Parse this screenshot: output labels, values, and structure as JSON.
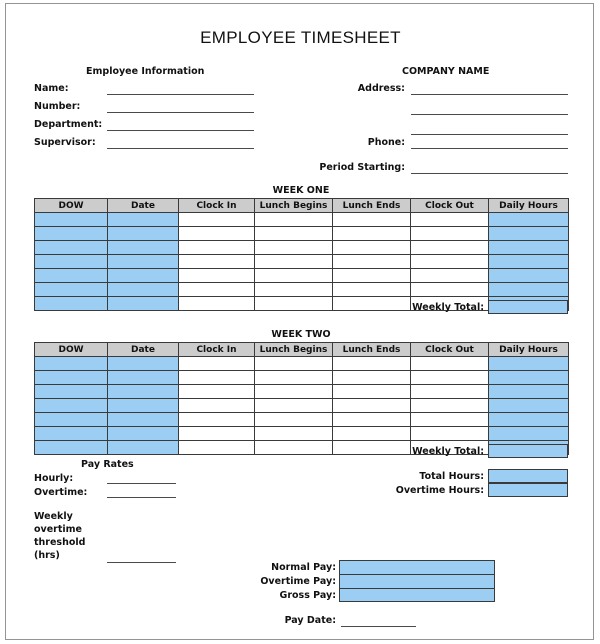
{
  "document": {
    "title": "EMPLOYEE TIMESHEET"
  },
  "employee_information": {
    "caption": "Employee Information",
    "fields": [
      {
        "label": "Name:",
        "value": ""
      },
      {
        "label": "Number:",
        "value": ""
      },
      {
        "label": "Department:",
        "value": ""
      },
      {
        "label": "Supervisor:",
        "value": ""
      }
    ]
  },
  "company_information": {
    "caption": "COMPANY NAME",
    "fields": [
      {
        "label": "Address:",
        "value": ""
      },
      {
        "label": "",
        "value": ""
      },
      {
        "label": "",
        "value": ""
      },
      {
        "label": "Phone:",
        "value": ""
      },
      {
        "label": "Period Starting:",
        "value": ""
      }
    ]
  },
  "week_one": {
    "title": "WEEK ONE",
    "columns": [
      "DOW",
      "Date",
      "Clock In",
      "Lunch Begins",
      "Lunch Ends",
      "Clock Out",
      "Daily Hours"
    ],
    "rows": [
      {
        "dow": "",
        "date": "",
        "clock_in": "",
        "lunch_begins": "",
        "lunch_ends": "",
        "clock_out": "",
        "daily_hours": ""
      },
      {
        "dow": "",
        "date": "",
        "clock_in": "",
        "lunch_begins": "",
        "lunch_ends": "",
        "clock_out": "",
        "daily_hours": ""
      },
      {
        "dow": "",
        "date": "",
        "clock_in": "",
        "lunch_begins": "",
        "lunch_ends": "",
        "clock_out": "",
        "daily_hours": ""
      },
      {
        "dow": "",
        "date": "",
        "clock_in": "",
        "lunch_begins": "",
        "lunch_ends": "",
        "clock_out": "",
        "daily_hours": ""
      },
      {
        "dow": "",
        "date": "",
        "clock_in": "",
        "lunch_begins": "",
        "lunch_ends": "",
        "clock_out": "",
        "daily_hours": ""
      },
      {
        "dow": "",
        "date": "",
        "clock_in": "",
        "lunch_begins": "",
        "lunch_ends": "",
        "clock_out": "",
        "daily_hours": ""
      },
      {
        "dow": "",
        "date": "",
        "clock_in": "",
        "lunch_begins": "",
        "lunch_ends": "",
        "clock_out": "",
        "daily_hours": ""
      }
    ],
    "weekly_total_label": "Weekly Total:",
    "weekly_total_value": ""
  },
  "week_two": {
    "title": "WEEK TWO",
    "columns": [
      "DOW",
      "Date",
      "Clock In",
      "Lunch Begins",
      "Lunch Ends",
      "Clock Out",
      "Daily Hours"
    ],
    "rows": [
      {
        "dow": "",
        "date": "",
        "clock_in": "",
        "lunch_begins": "",
        "lunch_ends": "",
        "clock_out": "",
        "daily_hours": ""
      },
      {
        "dow": "",
        "date": "",
        "clock_in": "",
        "lunch_begins": "",
        "lunch_ends": "",
        "clock_out": "",
        "daily_hours": ""
      },
      {
        "dow": "",
        "date": "",
        "clock_in": "",
        "lunch_begins": "",
        "lunch_ends": "",
        "clock_out": "",
        "daily_hours": ""
      },
      {
        "dow": "",
        "date": "",
        "clock_in": "",
        "lunch_begins": "",
        "lunch_ends": "",
        "clock_out": "",
        "daily_hours": ""
      },
      {
        "dow": "",
        "date": "",
        "clock_in": "",
        "lunch_begins": "",
        "lunch_ends": "",
        "clock_out": "",
        "daily_hours": ""
      },
      {
        "dow": "",
        "date": "",
        "clock_in": "",
        "lunch_begins": "",
        "lunch_ends": "",
        "clock_out": "",
        "daily_hours": ""
      },
      {
        "dow": "",
        "date": "",
        "clock_in": "",
        "lunch_begins": "",
        "lunch_ends": "",
        "clock_out": "",
        "daily_hours": ""
      }
    ],
    "weekly_total_label": "Weekly Total:",
    "weekly_total_value": ""
  },
  "pay_rates": {
    "caption": "Pay Rates",
    "hourly_label": "Hourly:",
    "hourly_value": "",
    "overtime_label": "Overtime:",
    "overtime_value": "",
    "threshold_label": "Weekly overtime threshold (hrs)",
    "threshold_value": ""
  },
  "hours_summary": {
    "total_hours_label": "Total Hours:",
    "total_hours_value": "",
    "overtime_hours_label": "Overtime Hours:",
    "overtime_hours_value": ""
  },
  "pay_summary": {
    "normal_pay_label": "Normal Pay:",
    "normal_pay_value": "",
    "overtime_pay_label": "Overtime Pay:",
    "overtime_pay_value": "",
    "gross_pay_label": "Gross Pay:",
    "gross_pay_value": "",
    "pay_date_label": "Pay Date:",
    "pay_date_value": ""
  },
  "colors": {
    "fill_blue": "#9ccdf2",
    "header_gray": "#cccccc",
    "border": "#3a3a3a",
    "page_border": "#949494"
  }
}
